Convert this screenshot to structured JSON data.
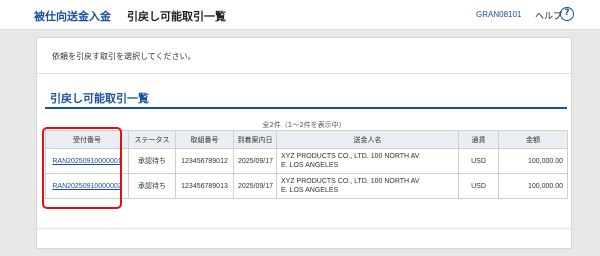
{
  "header": {
    "module": "被仕向送金入金",
    "title": "引戻し可能取引一覧",
    "screen_id": "GRAN08101",
    "help_label": "ヘルプ",
    "help_icon": "?"
  },
  "instruction": "依頼を引戻す取引を選択してください。",
  "section_title": "引戻し可能取引一覧",
  "count_text": "全2件（1～2件を表示中）",
  "table": {
    "headers": [
      "受付番号",
      "ステータス",
      "取組番号",
      "到着案内日",
      "送金人名",
      "通貨",
      "金額"
    ],
    "rows": [
      {
        "receipt_no": "RAN20250910000001",
        "status": "承認待ち",
        "trade_no": "123456789012",
        "arrival_date": "2025/09/17",
        "remitter_line1": "XYZ PRODUCTS CO., LTD. 100 NORTH AV",
        "remitter_line2": "E. LOS ANGELES",
        "currency": "USD",
        "amount": "100,000.00"
      },
      {
        "receipt_no": "RAN20250910000002",
        "status": "承認待ち",
        "trade_no": "123456789013",
        "arrival_date": "2025/09/17",
        "remitter_line1": "XYZ PRODUCTS CO., LTD. 100 NORTH AV",
        "remitter_line2": "E. LOS ANGELES",
        "currency": "USD",
        "amount": "100,000.00"
      }
    ]
  },
  "colors": {
    "accent": "#1a4fa3",
    "highlight": "#e01010",
    "header_bg": "#eaeef3"
  }
}
